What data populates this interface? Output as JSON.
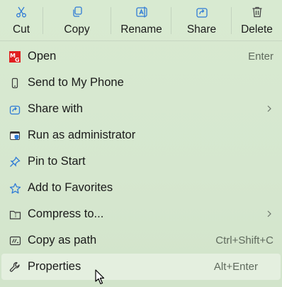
{
  "toolbar": {
    "cut": "Cut",
    "copy": "Copy",
    "rename": "Rename",
    "share": "Share",
    "delete": "Delete"
  },
  "items": [
    {
      "label": "Open",
      "shortcut": "Enter",
      "icon": "app-logo-icon"
    },
    {
      "label": "Send to My Phone",
      "shortcut": "",
      "icon": "phone-icon"
    },
    {
      "label": "Share with",
      "shortcut": "",
      "icon": "share-icon",
      "submenu": true
    },
    {
      "label": "Run as administrator",
      "shortcut": "",
      "icon": "shield-window-icon"
    },
    {
      "label": "Pin to Start",
      "shortcut": "",
      "icon": "pin-icon"
    },
    {
      "label": "Add to Favorites",
      "shortcut": "",
      "icon": "star-icon"
    },
    {
      "label": "Compress to...",
      "shortcut": "",
      "icon": "zip-folder-icon",
      "submenu": true
    },
    {
      "label": "Copy as path",
      "shortcut": "Ctrl+Shift+C",
      "icon": "copy-path-icon"
    },
    {
      "label": "Properties",
      "shortcut": "Alt+Enter",
      "icon": "wrench-icon"
    }
  ],
  "colors": {
    "accent": "#2f7bd6",
    "background": "#d6e7cf",
    "hover": "#e4efdf"
  }
}
